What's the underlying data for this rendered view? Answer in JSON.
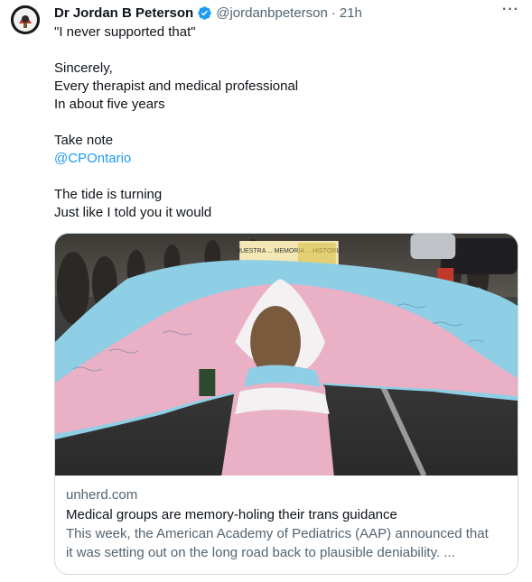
{
  "tweet": {
    "author_name": "Dr Jordan B Peterson",
    "handle": "@jordanbpeterson",
    "separator": "·",
    "time": "21h",
    "more_icon": "more-horizontal-icon",
    "verified_icon": "verified-badge-icon",
    "text_lines": {
      "l1": "\"I never supported that\"",
      "l2": "Sincerely,",
      "l3": "Every therapist and medical professional",
      "l4": "In about five years",
      "l5": "Take note",
      "mention": "@CPOntario",
      "l7": "The tide is turning",
      "l8": "Just like I told you it would"
    }
  },
  "card": {
    "domain": "unherd.com",
    "title": "Medical groups are memory-holing their trans guidance",
    "description_lines": {
      "d1": "This week, the American Academy of Pediatrics (AAP) announced that",
      "d2": "it was setting out on the long road back to plausible deniability.  ..."
    },
    "banner_text": "NUESTRA ... MEMORIA ... HISTORIA"
  },
  "colors": {
    "accent": "#1d9bf0",
    "text": "#0f1419",
    "secondary": "#536471",
    "border": "#cfd9de",
    "flag_blue": "#8ecfe6",
    "flag_pink": "#e9b0c6",
    "flag_white": "#f4f1f2"
  }
}
